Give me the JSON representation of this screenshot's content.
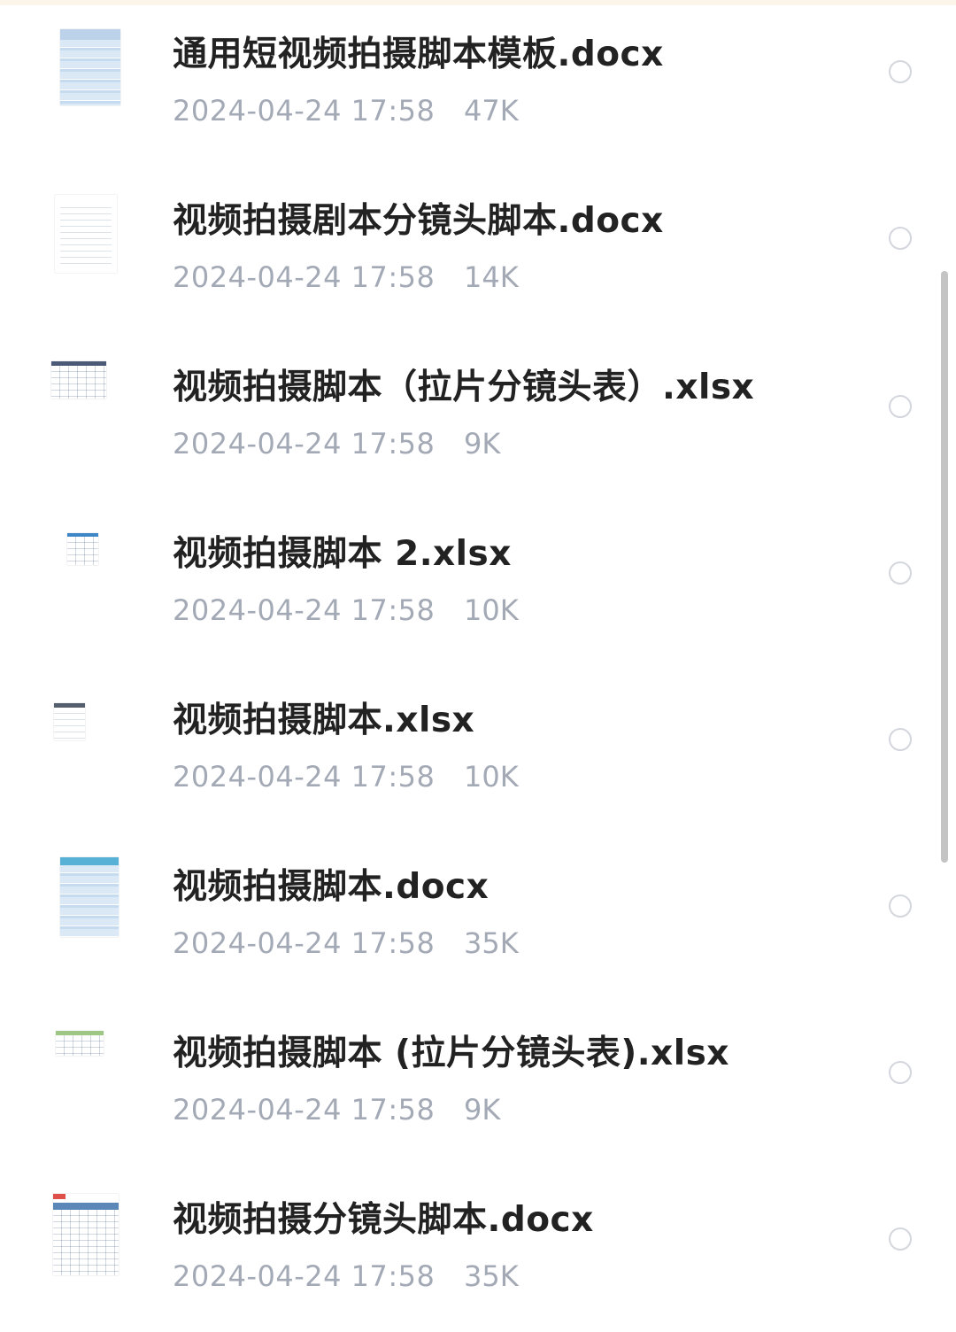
{
  "colors": {
    "filename": "#222222",
    "meta": "#a3aab6",
    "radio_border": "#d3d6dc",
    "scrollbar": "#c4c4c4",
    "top_strip": "#fbf6e9"
  },
  "files": [
    {
      "name": "通用短视频拍摄脚本模板.docx",
      "date": "2024-04-24 17:58",
      "size": "47K",
      "thumb_icon": "docx-blue-table-thumbnail"
    },
    {
      "name": "视频拍摄剧本分镜头脚本.docx",
      "date": "2024-04-24 17:58",
      "size": "14K",
      "thumb_icon": "docx-text-thumbnail"
    },
    {
      "name": "视频拍摄脚本（拉片分镜头表）.xlsx",
      "date": "2024-04-24 17:58",
      "size": "9K",
      "thumb_icon": "xlsx-grid-thumbnail"
    },
    {
      "name": "视频拍摄脚本 2.xlsx",
      "date": "2024-04-24 17:58",
      "size": "10K",
      "thumb_icon": "xlsx-grid-thumbnail"
    },
    {
      "name": "视频拍摄脚本.xlsx",
      "date": "2024-04-24 17:58",
      "size": "10K",
      "thumb_icon": "xlsx-grid-thumbnail"
    },
    {
      "name": "视频拍摄脚本.docx",
      "date": "2024-04-24 17:58",
      "size": "35K",
      "thumb_icon": "docx-blue-table-thumbnail"
    },
    {
      "name": "视频拍摄脚本 (拉片分镜头表).xlsx",
      "date": "2024-04-24 17:58",
      "size": "9K",
      "thumb_icon": "xlsx-green-header-thumbnail"
    },
    {
      "name": "视频拍摄分镜头脚本.docx",
      "date": "2024-04-24 17:58",
      "size": "35K",
      "thumb_icon": "docx-table-thumbnail"
    }
  ]
}
